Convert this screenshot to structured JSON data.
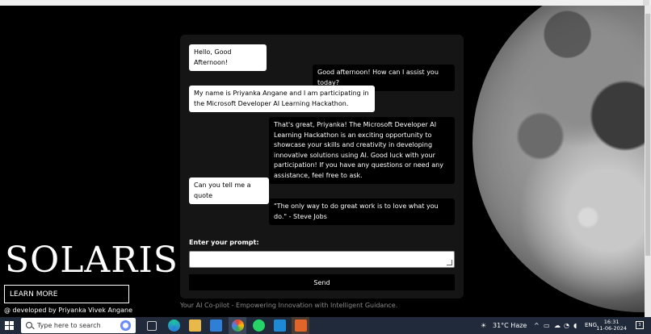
{
  "brand": {
    "title": "SOLARIS",
    "learn_more_label": "LEARN MORE",
    "developed_by": "@ developed by Priyanka Vivek Angane"
  },
  "chat": {
    "messages": [
      {
        "role": "user",
        "text": "Hello, Good Afternoon!"
      },
      {
        "role": "bot",
        "text": "Good afternoon! How can I assist you today?"
      },
      {
        "role": "user",
        "text": "My name is Priyanka Angane and I am participating in the Microsoft Developer AI Learning Hackathon."
      },
      {
        "role": "bot",
        "text": "That's great, Priyanka! The Microsoft Developer AI Learning Hackathon is an exciting opportunity to showcase your skills and creativity in developing innovative solutions using AI. Good luck with your participation! If you have any questions or need any assistance, feel free to ask."
      },
      {
        "role": "user",
        "text": "Can you tell me a quote"
      },
      {
        "role": "bot",
        "text": "\"The only way to do great work is to love what you do.\" - Steve Jobs"
      }
    ],
    "prompt_label": "Enter your prompt:",
    "prompt_value": "",
    "send_label": "Send",
    "tagline": "Your AI Co-pilot - Empowering Innovation with Intelligent Guidance."
  },
  "taskbar": {
    "search_placeholder": "Type here to search",
    "weather": "31°C  Haze",
    "language": "ENG",
    "time": "16:31",
    "date": "11-06-2024",
    "notification_count": "3",
    "apps": [
      "task-view-icon",
      "edge-icon",
      "file-explorer-icon",
      "mail-icon",
      "browser-icon",
      "whatsapp-icon",
      "vscode-icon",
      "app-icon"
    ]
  },
  "colors": {
    "panel_bg": "#151515",
    "bot_bubble": "#000000",
    "user_bubble": "#ffffff",
    "taskbar_bg": "#202a3a"
  }
}
